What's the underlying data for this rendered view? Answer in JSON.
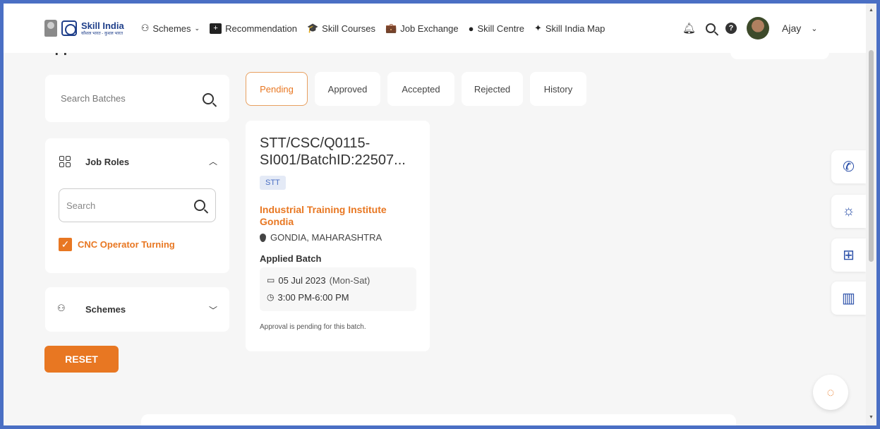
{
  "header": {
    "logo_title": "Skill India",
    "logo_subtitle": "कौशल भारत - कुशल भारत",
    "nav": [
      {
        "label": "Schemes",
        "icon": "handshake-icon",
        "glyph": "⚇",
        "has_dropdown": true
      },
      {
        "label": "Recommendation",
        "icon": "plus-box-icon",
        "glyph": "+"
      },
      {
        "label": "Skill Courses",
        "icon": "graduation-cap-icon",
        "glyph": "🎓"
      },
      {
        "label": "Job Exchange",
        "icon": "briefcase-icon",
        "glyph": "💼"
      },
      {
        "label": "Skill Centre",
        "icon": "location-pin-icon",
        "glyph": "●"
      },
      {
        "label": "Skill India Map",
        "icon": "map-marker-icon",
        "glyph": "✦"
      }
    ],
    "user_name": "Ajay",
    "partial_page_title": "Applied Batches"
  },
  "sidebar": {
    "search_placeholder": "Search Batches",
    "job_roles_title": "Job Roles",
    "job_roles_search_placeholder": "Search",
    "job_roles_checked": "CNC Operator Turning",
    "schemes_title": "Schemes",
    "reset_label": "RESET"
  },
  "tabs": [
    {
      "label": "Pending",
      "active": true
    },
    {
      "label": "Approved",
      "active": false
    },
    {
      "label": "Accepted",
      "active": false
    },
    {
      "label": "Rejected",
      "active": false
    },
    {
      "label": "History",
      "active": false
    }
  ],
  "batch": {
    "id": "STT/CSC/Q0115-SI001/BatchID:22507...",
    "badge": "STT",
    "institute": "Industrial Training Institute Gondia",
    "location": "GONDIA, MAHARASHTRA",
    "applied_title": "Applied Batch",
    "date": "05 Jul 2023",
    "days": "(Mon-Sat)",
    "time": "3:00 PM-6:00 PM",
    "note": "Approval is pending for this batch."
  },
  "colors": {
    "accent": "#e87722",
    "brand_blue": "#2a4fa8",
    "background": "#f6f6f6"
  }
}
